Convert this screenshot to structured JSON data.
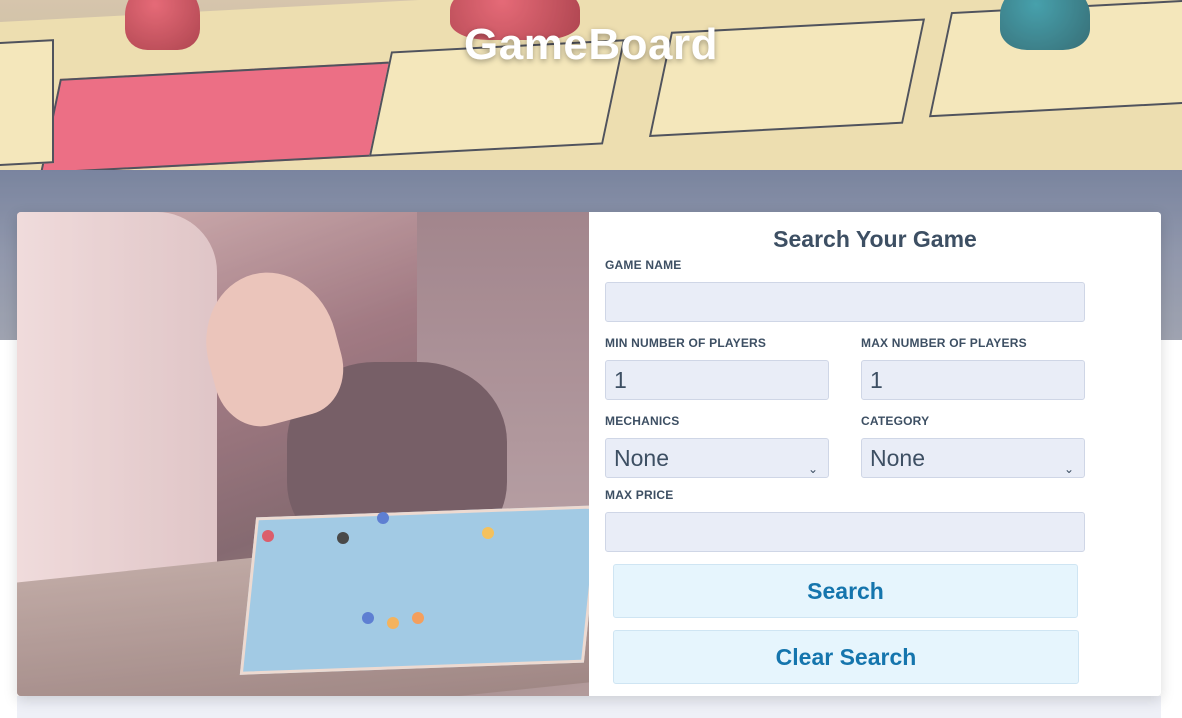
{
  "header": {
    "title": "GameBoard"
  },
  "search_form": {
    "heading": "Search Your Game",
    "game_name": {
      "label": "GAME NAME",
      "value": ""
    },
    "min_players": {
      "label": "MIN NUMBER OF PLAYERS",
      "value": "1"
    },
    "max_players": {
      "label": "MAX NUMBER OF PLAYERS",
      "value": "1"
    },
    "mechanics": {
      "label": "MECHANICS",
      "value": "None"
    },
    "category": {
      "label": "CATEGORY",
      "value": "None"
    },
    "max_price": {
      "label": "MAX PRICE",
      "value": ""
    },
    "search_button": "Search",
    "clear_button": "Clear Search"
  },
  "colors": {
    "accent_text": "#1575ad",
    "label_text": "#3d4f63",
    "field_bg": "#e9edf7",
    "button_bg": "#e6f5fd"
  },
  "icons": {
    "select_chevron": "chevron-down-icon"
  }
}
